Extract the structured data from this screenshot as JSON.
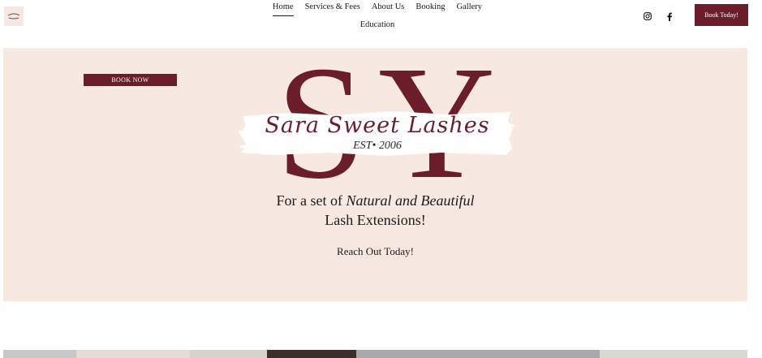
{
  "header": {
    "nav": [
      {
        "label": "Home",
        "active": true
      },
      {
        "label": "Services & Fees"
      },
      {
        "label": "About Us"
      },
      {
        "label": "Booking"
      },
      {
        "label": "Gallery"
      }
    ],
    "nav_second_row": "Education",
    "social_icons": [
      "instagram-icon",
      "facebook-icon"
    ],
    "cta_label": "Book Today!"
  },
  "hero": {
    "book_now_label": "BOOK NOW",
    "monogram": {
      "left": "S",
      "right": "Y"
    },
    "script_title": "Sara Sweet Lashes",
    "est": "EST• 2006",
    "tagline_prefix": "For a set of",
    "tagline_italic": "Natural and Beautiful",
    "tagline_line2": "Lash Extensions!",
    "reach_out": "Reach Out Today!"
  },
  "colors": {
    "accent": "#6b1d2a",
    "hero_background": "#f7e8e1",
    "logo_background": "#f6e7e1"
  }
}
